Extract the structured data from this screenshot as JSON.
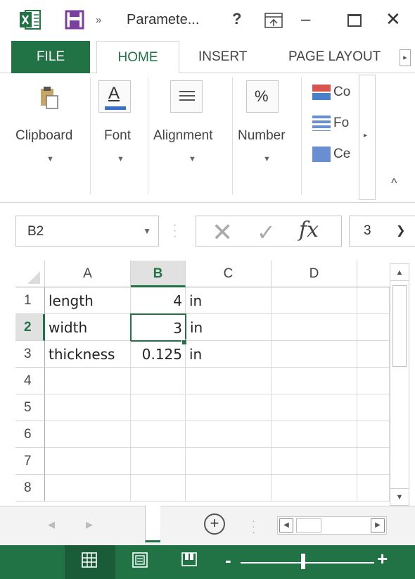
{
  "titlebar": {
    "title": "Paramete...",
    "help": "?",
    "more": "»"
  },
  "tabs": {
    "file": "FILE",
    "home": "HOME",
    "insert": "INSERT",
    "page_layout": "PAGE LAYOUT"
  },
  "ribbon": {
    "groups": [
      {
        "label": "Clipboard",
        "icon": "paste-icon"
      },
      {
        "label": "Font",
        "icon": "font-color-icon"
      },
      {
        "label": "Alignment",
        "icon": "align-icon"
      },
      {
        "label": "Number",
        "icon": "percent-icon",
        "symbol": "%"
      }
    ],
    "styles": [
      "Co",
      "Fo",
      "Ce"
    ]
  },
  "formula_bar": {
    "name_box": "B2",
    "value": "3",
    "fx": "fx"
  },
  "grid": {
    "columns": [
      "A",
      "B",
      "C",
      "D"
    ],
    "active_column": "B",
    "rows": [
      "1",
      "2",
      "3",
      "4",
      "5",
      "6",
      "7",
      "8"
    ],
    "active_row": "2",
    "cells": [
      {
        "a": "length",
        "b": "4",
        "c": "in"
      },
      {
        "a": "width",
        "b": "3",
        "c": "in"
      },
      {
        "a": "thickness",
        "b": "0.125",
        "c": "in"
      },
      {
        "a": "",
        "b": "",
        "c": ""
      },
      {
        "a": "",
        "b": "",
        "c": ""
      },
      {
        "a": "",
        "b": "",
        "c": ""
      },
      {
        "a": "",
        "b": "",
        "c": ""
      },
      {
        "a": "",
        "b": "",
        "c": ""
      }
    ]
  },
  "colors": {
    "accent": "#217346",
    "accent_dark": "#1a5c38"
  },
  "statusbar": {
    "zoom_minus": "-",
    "zoom_plus": "+"
  }
}
